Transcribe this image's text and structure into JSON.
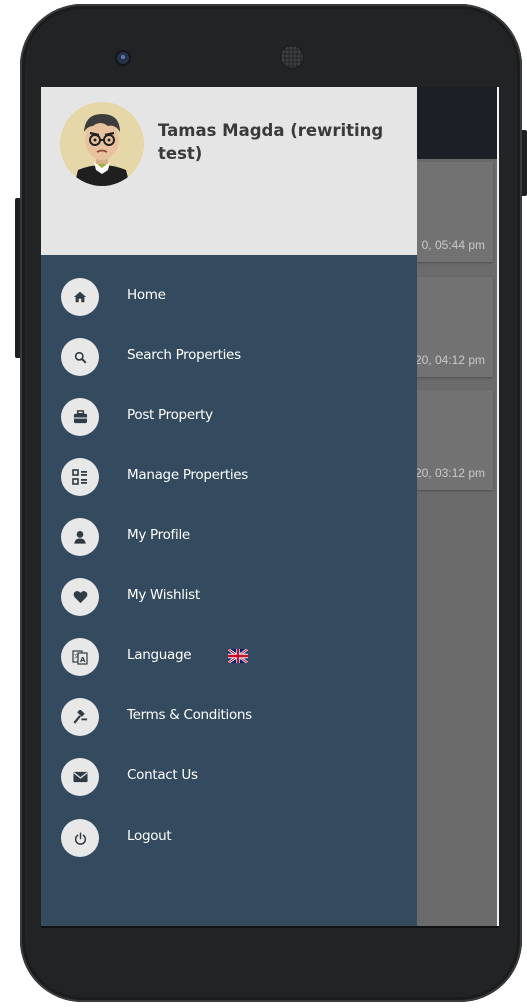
{
  "user": {
    "name": "Tamas Magda (rewriting test)"
  },
  "background_list": {
    "dates": [
      "0, 05:44 pm",
      "20, 04:12 pm",
      "20, 03:12 pm"
    ]
  },
  "menu": {
    "items": [
      {
        "label": "Home",
        "icon": "home-icon"
      },
      {
        "label": "Search Properties",
        "icon": "search-icon"
      },
      {
        "label": "Post Property",
        "icon": "briefcase-icon"
      },
      {
        "label": "Manage Properties",
        "icon": "grid-list-icon"
      },
      {
        "label": "My Profile",
        "icon": "user-icon"
      },
      {
        "label": "My Wishlist",
        "icon": "heart-icon"
      },
      {
        "label": "Language",
        "icon": "translate-icon",
        "flag": "uk-flag-icon"
      },
      {
        "label": "Terms & Conditions",
        "icon": "gavel-icon"
      },
      {
        "label": "Contact Us",
        "icon": "envelope-icon"
      },
      {
        "label": "Logout",
        "icon": "power-icon"
      }
    ]
  },
  "colors": {
    "drawer_background": "#344b5f",
    "drawer_header_background": "#e5e5e5",
    "icon_circle": "#e8e8e8",
    "icon_glyph": "#2f3b45",
    "app_header": "#1b1f26",
    "phone_body": "#222325"
  }
}
